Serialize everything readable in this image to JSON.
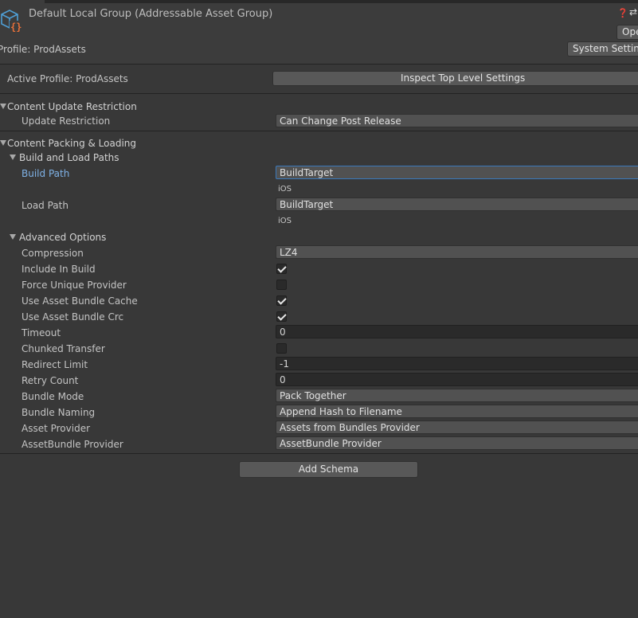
{
  "header": {
    "title": "Default Local Group (Addressable Asset Group)",
    "help_icon": "help-icon",
    "settings_icon": "presets-icon",
    "open_button": "Ope",
    "profile_label": "Profile: ProdAssets",
    "system_settings_button": "System Setting"
  },
  "active_profile": {
    "label": "Active Profile: ProdAssets",
    "button": "Inspect Top Level Settings"
  },
  "content_update": {
    "section_title": "Content Update Restriction",
    "restriction_label": "Update Restriction",
    "restriction_value": "Can Change Post Release"
  },
  "packing": {
    "section_title": "Content Packing & Loading",
    "build_load_title": "Build and Load Paths",
    "build_path_label": "Build Path",
    "build_path_value": "BuildTarget",
    "build_path_resolved": "iOS",
    "load_path_label": "Load Path",
    "load_path_value": "BuildTarget",
    "load_path_resolved": "iOS",
    "advanced_title": "Advanced Options",
    "compression_label": "Compression",
    "compression_value": "LZ4",
    "include_in_build_label": "Include In Build",
    "include_in_build": true,
    "force_unique_label": "Force Unique Provider",
    "force_unique": false,
    "use_cache_label": "Use Asset Bundle Cache",
    "use_cache": true,
    "use_crc_label": "Use Asset Bundle Crc",
    "use_crc": true,
    "timeout_label": "Timeout",
    "timeout_value": "0",
    "chunked_label": "Chunked Transfer",
    "chunked": false,
    "redirect_label": "Redirect Limit",
    "redirect_value": "-1",
    "retry_label": "Retry Count",
    "retry_value": "0",
    "bundle_mode_label": "Bundle Mode",
    "bundle_mode_value": "Pack Together",
    "bundle_naming_label": "Bundle Naming",
    "bundle_naming_value": "Append Hash to Filename",
    "asset_provider_label": "Asset Provider",
    "asset_provider_value": "Assets from Bundles Provider",
    "bundle_provider_label": "AssetBundle Provider",
    "bundle_provider_value": "AssetBundle Provider"
  },
  "add_schema_button": "Add Schema",
  "colors": {
    "background": "#383838",
    "header": "#3c3c3c",
    "selected_label": "#7fb2e6",
    "focus_border": "#3a79bb",
    "icon_orange": "#e8703a",
    "icon_blue": "#4f9fd6"
  }
}
